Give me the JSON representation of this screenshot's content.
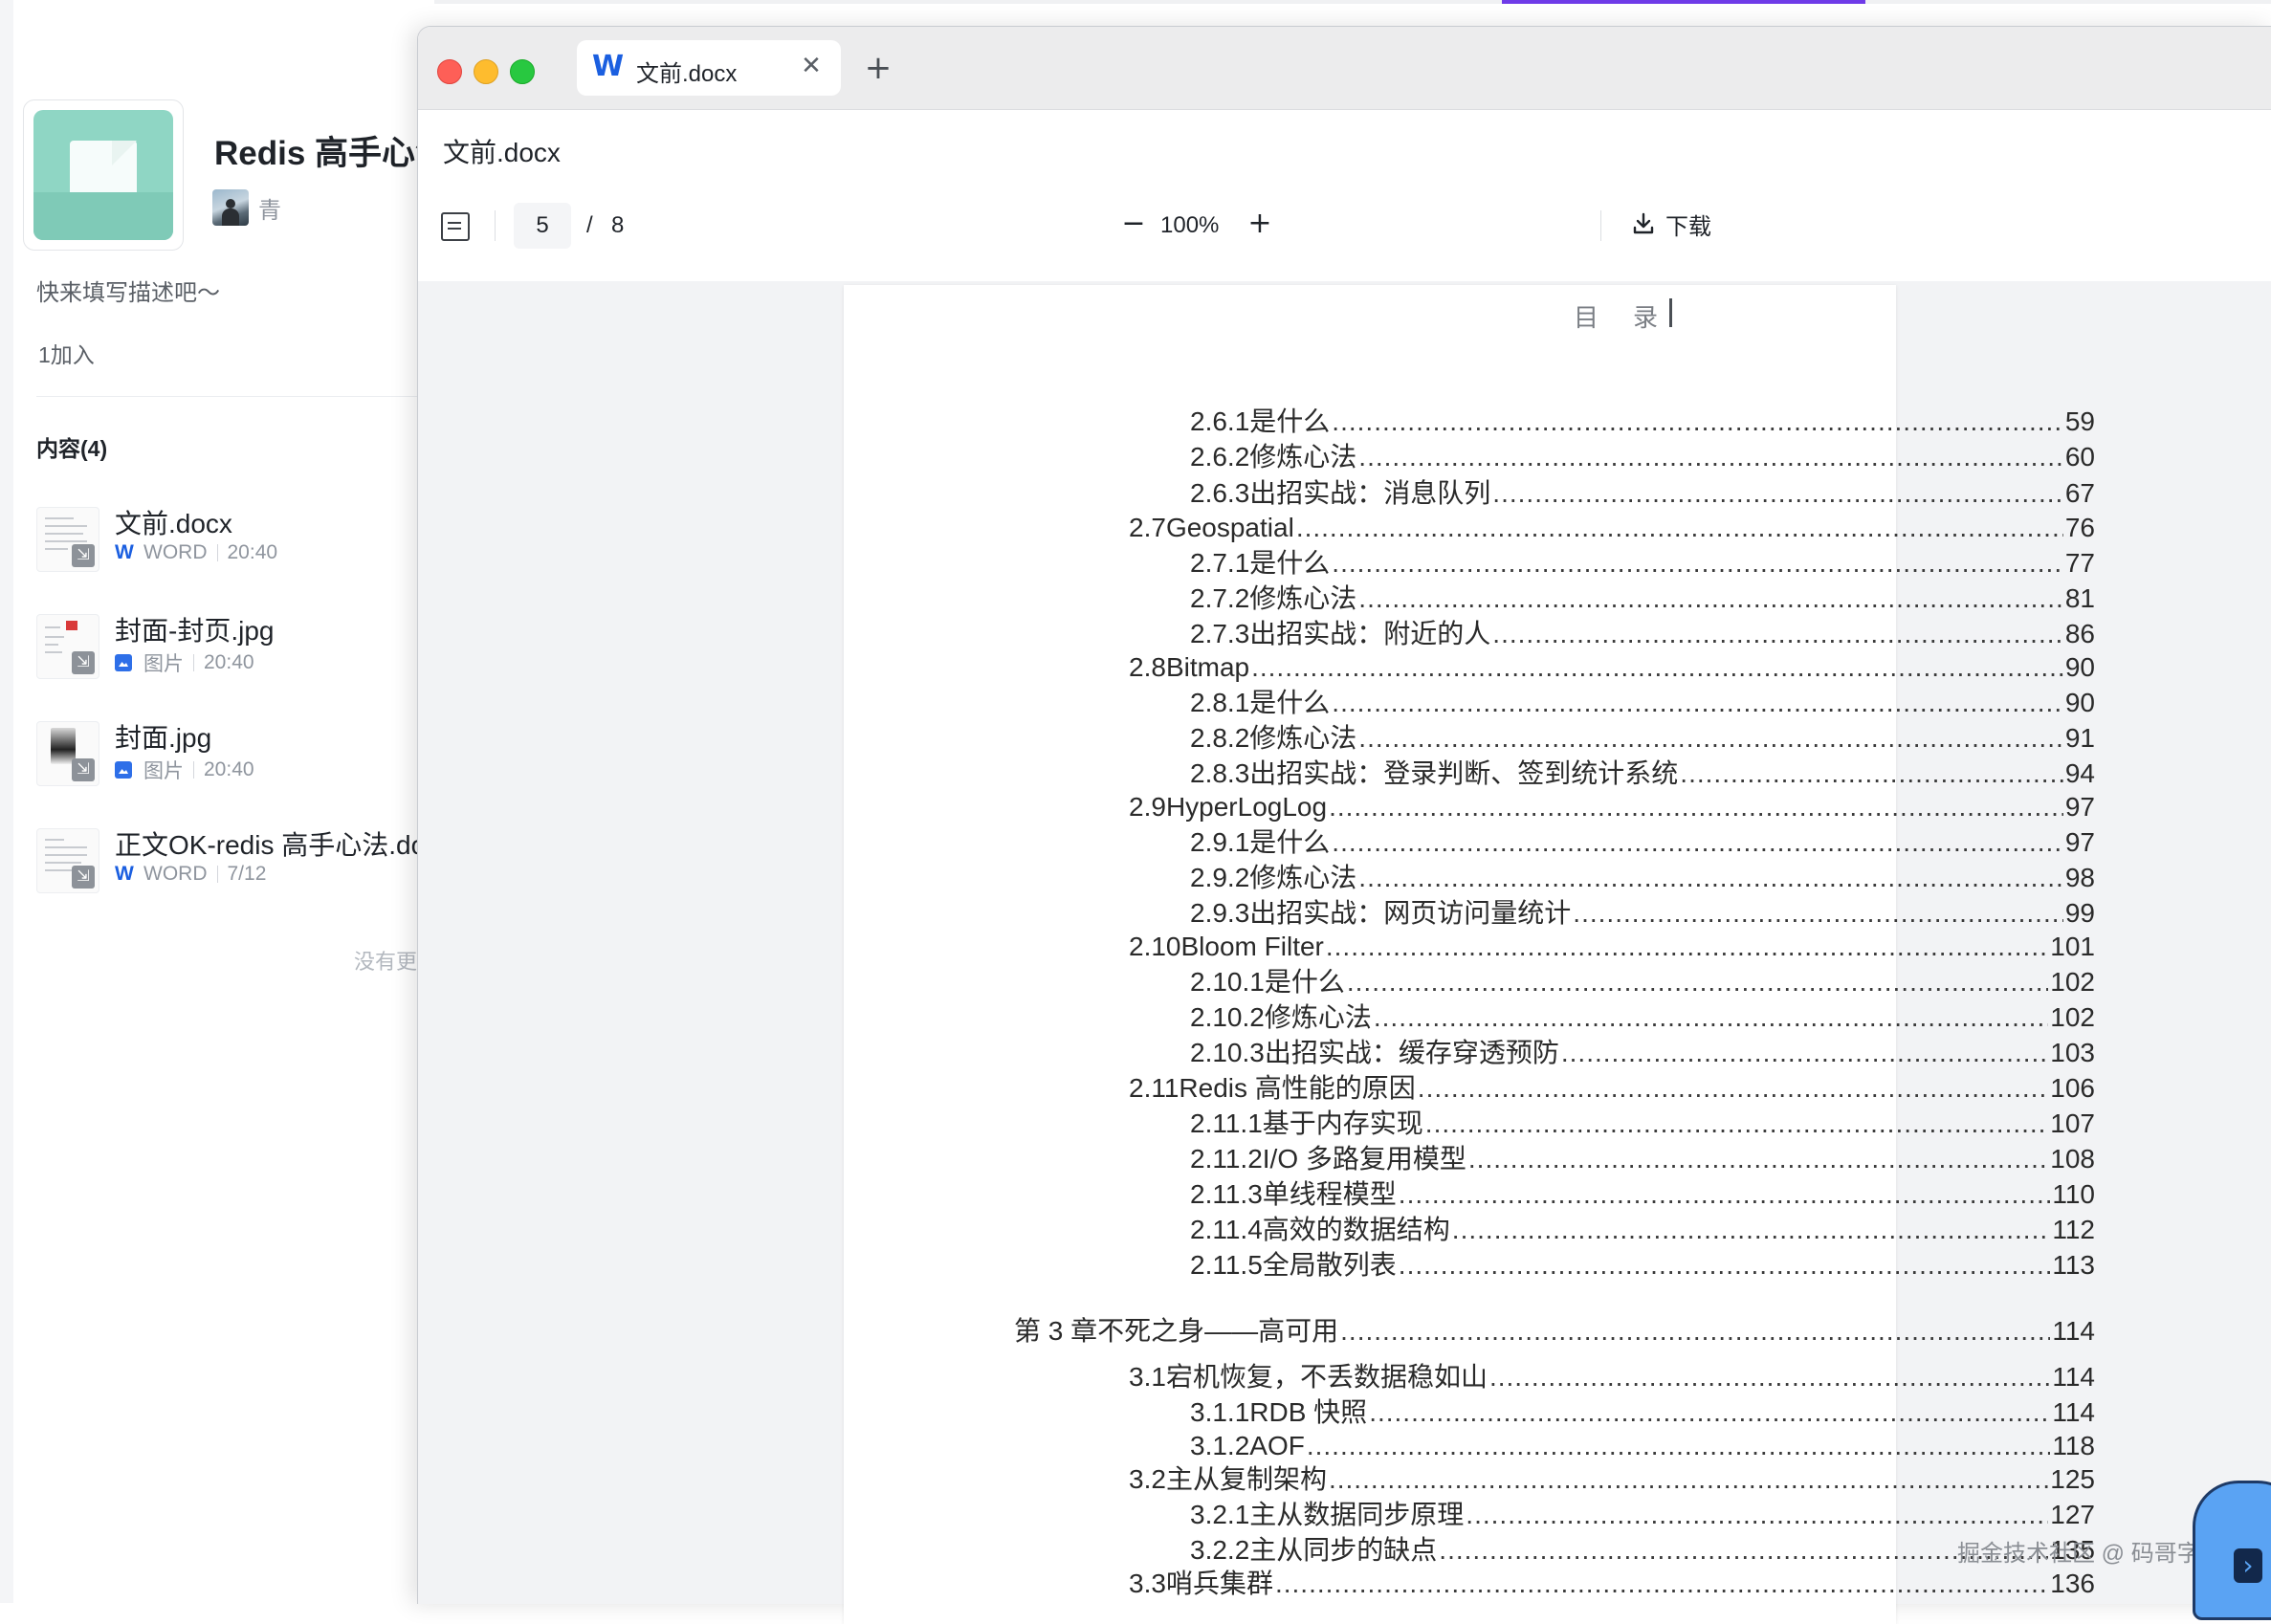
{
  "knowledge_base": {
    "title": "Redis 高手心法",
    "owner": "青",
    "description": "快来填写描述吧～",
    "joined": "1加入",
    "section_label": "内容(4)",
    "files": [
      {
        "name": "文前.docx",
        "type_label": "WORD",
        "time": "20:40",
        "kind": "word"
      },
      {
        "name": "封面-封页.jpg",
        "type_label": "图片",
        "time": "20:40",
        "kind": "image"
      },
      {
        "name": "封面.jpg",
        "type_label": "图片",
        "time": "20:40",
        "kind": "image"
      },
      {
        "name": "正文OK-redis 高手心法.docx",
        "type_label": "WORD",
        "time": "7/12",
        "kind": "word"
      }
    ],
    "no_more": "没有更多了"
  },
  "viewer": {
    "tab_label": "文前.docx",
    "doc_title": "文前.docx",
    "current_page": "5",
    "page_separator": "/",
    "total_pages": "8",
    "zoom": "100%",
    "download_label": "下载",
    "page_header_a": "目",
    "page_header_b": "录"
  },
  "toc": [
    {
      "num": "2.6.1",
      "text": "是什么",
      "page": "59"
    },
    {
      "num": "2.6.2",
      "text": "修炼心法",
      "page": "60"
    },
    {
      "num": "2.6.3",
      "text": "出招实战：消息队列",
      "page": "67"
    },
    {
      "num": "2.7",
      "text": "Geospatial",
      "page": "76"
    },
    {
      "num": "2.7.1",
      "text": "是什么",
      "page": "77"
    },
    {
      "num": "2.7.2",
      "text": "修炼心法",
      "page": "81"
    },
    {
      "num": "2.7.3",
      "text": "出招实战：附近的人",
      "page": "86"
    },
    {
      "num": "2.8",
      "text": "Bitmap",
      "page": "90"
    },
    {
      "num": "2.8.1",
      "text": "是什么",
      "page": "90"
    },
    {
      "num": "2.8.2",
      "text": "修炼心法",
      "page": "91"
    },
    {
      "num": "2.8.3",
      "text": "出招实战：登录判断、签到统计系统",
      "page": "94"
    },
    {
      "num": "2.9",
      "text": "HyperLogLog",
      "page": "97"
    },
    {
      "num": "2.9.1",
      "text": "是什么",
      "page": "97"
    },
    {
      "num": "2.9.2",
      "text": "修炼心法",
      "page": "98"
    },
    {
      "num": "2.9.3",
      "text": "出招实战：网页访问量统计",
      "page": "99"
    },
    {
      "num": "2.10",
      "text": "Bloom Filter",
      "page": "101"
    },
    {
      "num": "2.10.1",
      "text": "是什么",
      "page": "102"
    },
    {
      "num": "2.10.2",
      "text": "修炼心法",
      "page": "102"
    },
    {
      "num": "2.10.3",
      "text": "出招实战：缓存穿透预防",
      "page": "103"
    },
    {
      "num": "2.11",
      "text": "Redis 高性能的原因",
      "page": "106"
    },
    {
      "num": "2.11.1",
      "text": "基于内存实现",
      "page": "107"
    },
    {
      "num": "2.11.2",
      "text": "I/O  多路复用模型",
      "page": "108"
    },
    {
      "num": "2.11.3",
      "text": "单线程模型",
      "page": "110"
    },
    {
      "num": "2.11.4",
      "text": "高效的数据结构",
      "page": "112"
    },
    {
      "num": "2.11.5",
      "text": "全局散列表",
      "page": "113"
    },
    {
      "num": "第 3 章",
      "text": "不死之身——高可用",
      "page": "114"
    },
    {
      "num": "3.1",
      "text": "宕机恢复，不丢数据稳如山",
      "page": "114"
    },
    {
      "num": "3.1.1",
      "text": "RDB  快照",
      "page": "114"
    },
    {
      "num": "3.1.2",
      "text": "AOF",
      "page": "118"
    },
    {
      "num": "3.2",
      "text": "主从复制架构",
      "page": "125"
    },
    {
      "num": "3.2.1",
      "text": "主从数据同步原理",
      "page": "127"
    },
    {
      "num": "3.2.2",
      "text": "主从同步的缺点",
      "page": "135"
    },
    {
      "num": "3.3",
      "text": "哨兵集群",
      "page": "136"
    }
  ],
  "watermark": "掘金技术社区 @ 码哥字节",
  "colors": {
    "accent_blue": "#1b5fe0",
    "cover_green": "#8fd6c4",
    "traffic_red": "#fe5f57",
    "traffic_yellow": "#febc2e",
    "traffic_green": "#28c840"
  }
}
